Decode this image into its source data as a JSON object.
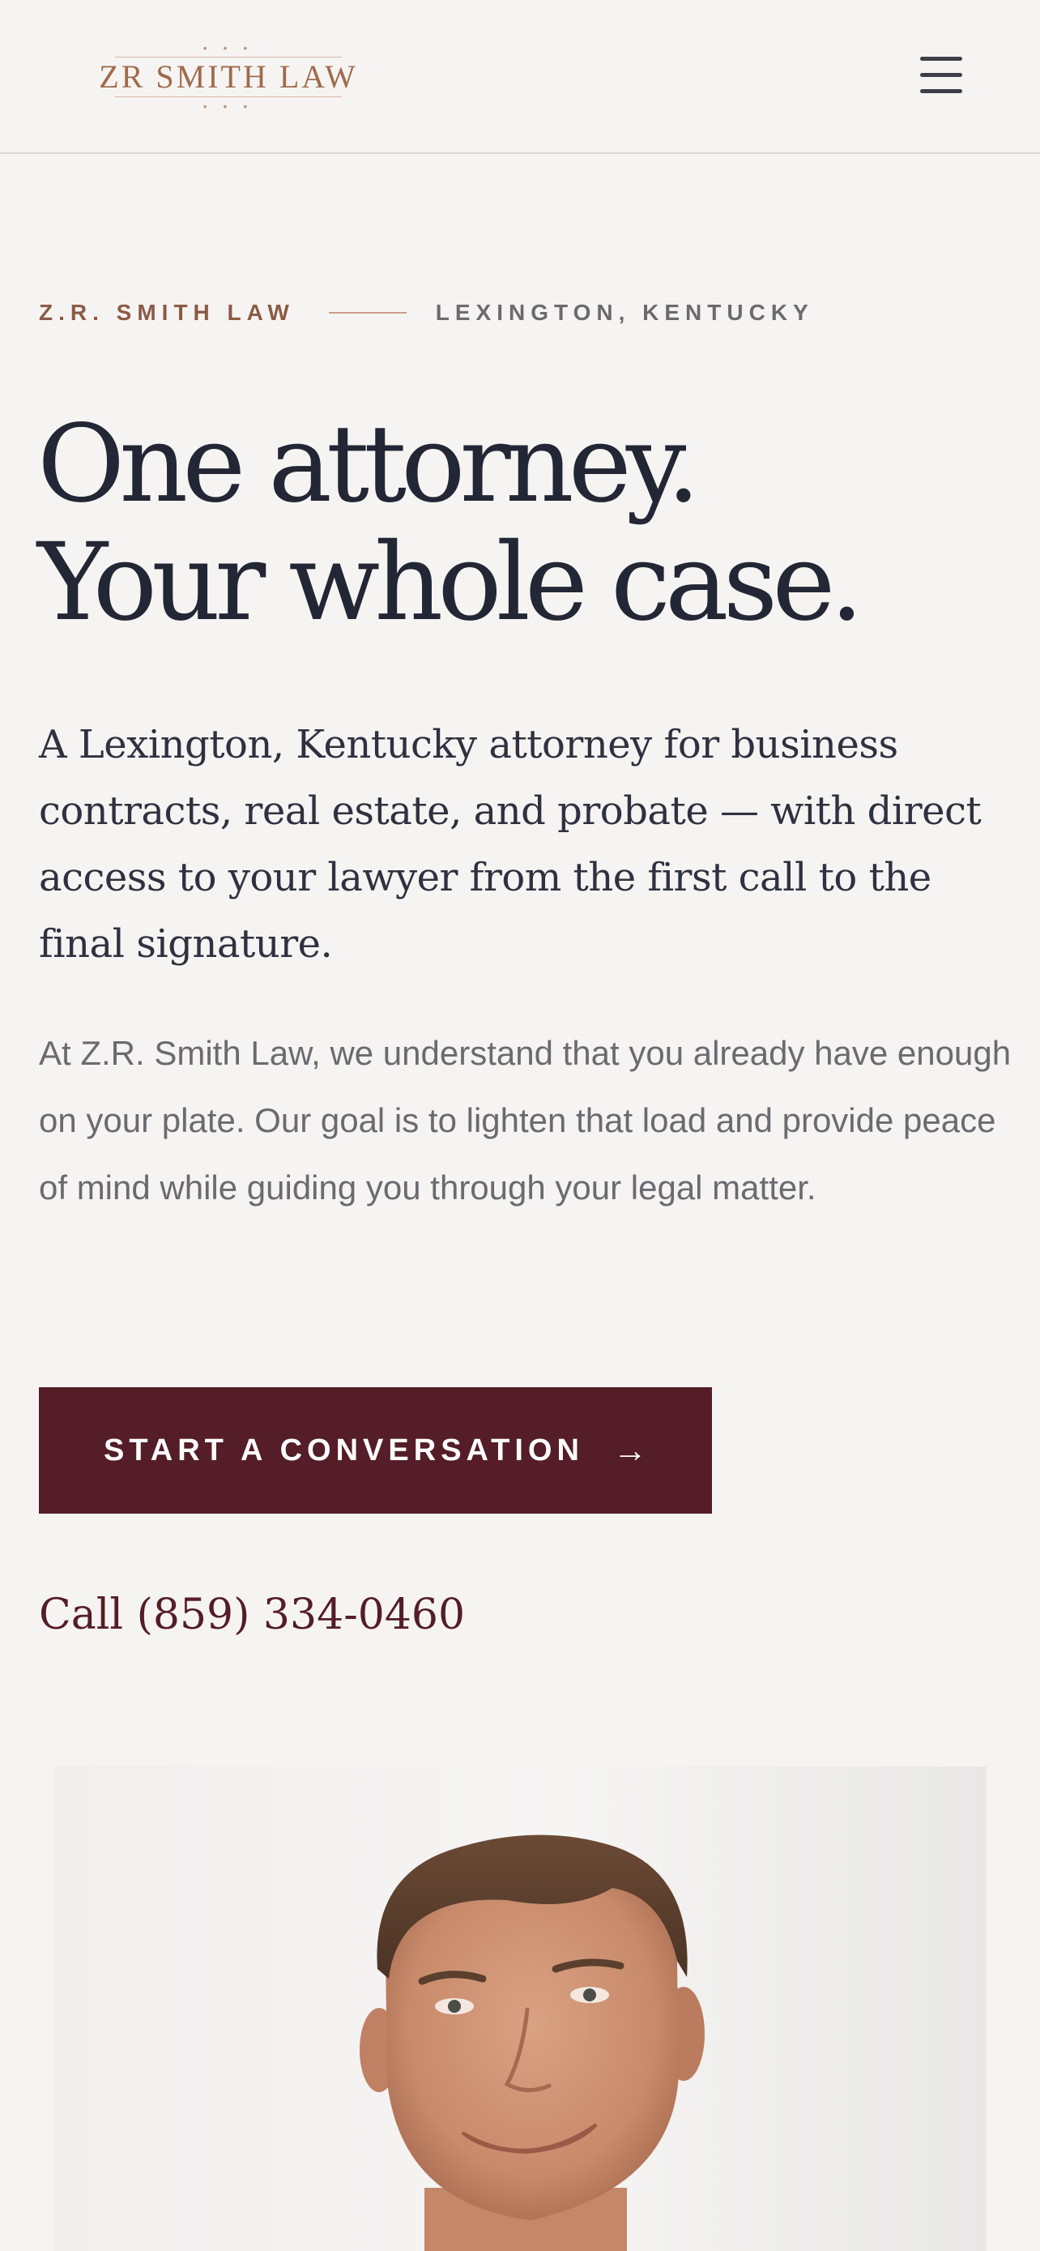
{
  "header": {
    "logo_text": "ZR SMITH LAW",
    "logo_dots": "• • •",
    "menu_icon": "hamburger-menu-icon"
  },
  "hero": {
    "eyebrow_firm": "Z.R. SMITH LAW",
    "eyebrow_location": "LEXINGTON, KENTUCKY",
    "headline_line1": "One attorney.",
    "headline_line2": "Your whole case.",
    "lead": "A Lexington, Kentucky attorney for business contracts, real estate, and probate — with direct access to your lawyer from the first call to the final signature.",
    "body": "At Z.R. Smith Law, we understand that you already have enough on your plate. Our goal is to lighten that load and provide peace of mind while guiding you through your legal matter.",
    "cta_label": "START A CONVERSATION",
    "cta_icon": "arrow-right-icon",
    "phone_text": "Call (859) 334-0460"
  },
  "colors": {
    "background": "#f6f4f2",
    "brand_maroon": "#541d27",
    "accent_copper": "#a06b4c",
    "headline": "#232634"
  }
}
